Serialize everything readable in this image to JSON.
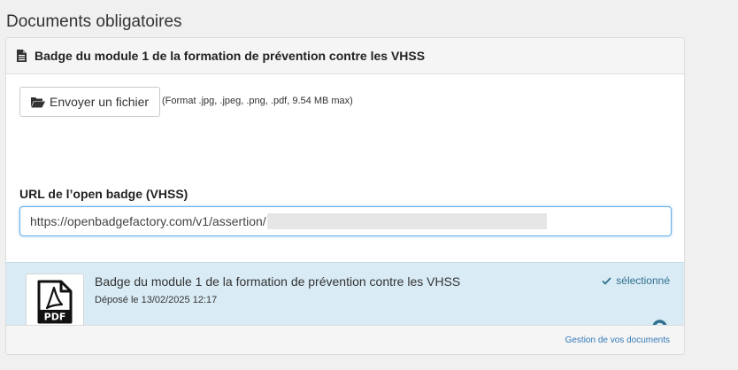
{
  "section": {
    "title": "Documents obligatoires"
  },
  "panel": {
    "heading": "Badge du module 1 de la formation de prévention contre les VHSS",
    "upload": {
      "button_label": "Envoyer un fichier",
      "format_note": "(Format .jpg, .jpeg, .png, .pdf, 9.54 MB max)"
    },
    "url_field": {
      "label": "URL de l’open badge (VHSS)",
      "value": "https://openbadgefactory.com/v1/assertion/"
    },
    "document": {
      "title": "Badge du module 1 de la formation de prévention contre les VHSS",
      "date": "Déposé le 13/02/2025 12:17",
      "status": "sélectionné",
      "thumb_label": "PDF"
    },
    "footer": {
      "link_label": "Gestion de vos documents"
    }
  },
  "colors": {
    "card_bg": "#d9ebf5",
    "accent": "#31708f",
    "link": "#337ab7",
    "input_focus": "#66afe9"
  },
  "icons": {
    "heading": "file-icon",
    "upload": "folder-open-icon",
    "thumb": "pdf-file-icon",
    "status": "check-icon",
    "lock": "lock-icon"
  }
}
